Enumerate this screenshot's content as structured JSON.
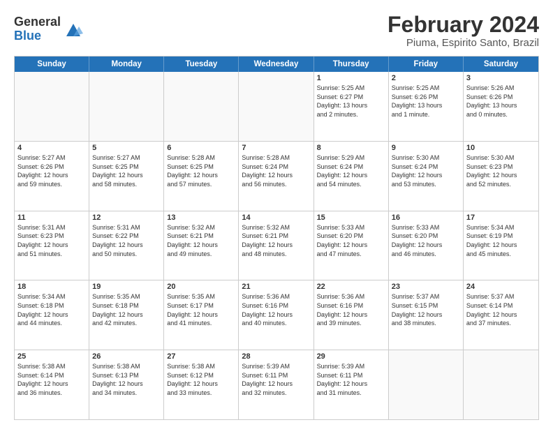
{
  "logo": {
    "general": "General",
    "blue": "Blue"
  },
  "title": "February 2024",
  "subtitle": "Piuma, Espirito Santo, Brazil",
  "header_days": [
    "Sunday",
    "Monday",
    "Tuesday",
    "Wednesday",
    "Thursday",
    "Friday",
    "Saturday"
  ],
  "weeks": [
    [
      {
        "day": "",
        "info": ""
      },
      {
        "day": "",
        "info": ""
      },
      {
        "day": "",
        "info": ""
      },
      {
        "day": "",
        "info": ""
      },
      {
        "day": "1",
        "info": "Sunrise: 5:25 AM\nSunset: 6:27 PM\nDaylight: 13 hours\nand 2 minutes."
      },
      {
        "day": "2",
        "info": "Sunrise: 5:25 AM\nSunset: 6:26 PM\nDaylight: 13 hours\nand 1 minute."
      },
      {
        "day": "3",
        "info": "Sunrise: 5:26 AM\nSunset: 6:26 PM\nDaylight: 13 hours\nand 0 minutes."
      }
    ],
    [
      {
        "day": "4",
        "info": "Sunrise: 5:27 AM\nSunset: 6:26 PM\nDaylight: 12 hours\nand 59 minutes."
      },
      {
        "day": "5",
        "info": "Sunrise: 5:27 AM\nSunset: 6:25 PM\nDaylight: 12 hours\nand 58 minutes."
      },
      {
        "day": "6",
        "info": "Sunrise: 5:28 AM\nSunset: 6:25 PM\nDaylight: 12 hours\nand 57 minutes."
      },
      {
        "day": "7",
        "info": "Sunrise: 5:28 AM\nSunset: 6:24 PM\nDaylight: 12 hours\nand 56 minutes."
      },
      {
        "day": "8",
        "info": "Sunrise: 5:29 AM\nSunset: 6:24 PM\nDaylight: 12 hours\nand 54 minutes."
      },
      {
        "day": "9",
        "info": "Sunrise: 5:30 AM\nSunset: 6:24 PM\nDaylight: 12 hours\nand 53 minutes."
      },
      {
        "day": "10",
        "info": "Sunrise: 5:30 AM\nSunset: 6:23 PM\nDaylight: 12 hours\nand 52 minutes."
      }
    ],
    [
      {
        "day": "11",
        "info": "Sunrise: 5:31 AM\nSunset: 6:23 PM\nDaylight: 12 hours\nand 51 minutes."
      },
      {
        "day": "12",
        "info": "Sunrise: 5:31 AM\nSunset: 6:22 PM\nDaylight: 12 hours\nand 50 minutes."
      },
      {
        "day": "13",
        "info": "Sunrise: 5:32 AM\nSunset: 6:21 PM\nDaylight: 12 hours\nand 49 minutes."
      },
      {
        "day": "14",
        "info": "Sunrise: 5:32 AM\nSunset: 6:21 PM\nDaylight: 12 hours\nand 48 minutes."
      },
      {
        "day": "15",
        "info": "Sunrise: 5:33 AM\nSunset: 6:20 PM\nDaylight: 12 hours\nand 47 minutes."
      },
      {
        "day": "16",
        "info": "Sunrise: 5:33 AM\nSunset: 6:20 PM\nDaylight: 12 hours\nand 46 minutes."
      },
      {
        "day": "17",
        "info": "Sunrise: 5:34 AM\nSunset: 6:19 PM\nDaylight: 12 hours\nand 45 minutes."
      }
    ],
    [
      {
        "day": "18",
        "info": "Sunrise: 5:34 AM\nSunset: 6:18 PM\nDaylight: 12 hours\nand 44 minutes."
      },
      {
        "day": "19",
        "info": "Sunrise: 5:35 AM\nSunset: 6:18 PM\nDaylight: 12 hours\nand 42 minutes."
      },
      {
        "day": "20",
        "info": "Sunrise: 5:35 AM\nSunset: 6:17 PM\nDaylight: 12 hours\nand 41 minutes."
      },
      {
        "day": "21",
        "info": "Sunrise: 5:36 AM\nSunset: 6:16 PM\nDaylight: 12 hours\nand 40 minutes."
      },
      {
        "day": "22",
        "info": "Sunrise: 5:36 AM\nSunset: 6:16 PM\nDaylight: 12 hours\nand 39 minutes."
      },
      {
        "day": "23",
        "info": "Sunrise: 5:37 AM\nSunset: 6:15 PM\nDaylight: 12 hours\nand 38 minutes."
      },
      {
        "day": "24",
        "info": "Sunrise: 5:37 AM\nSunset: 6:14 PM\nDaylight: 12 hours\nand 37 minutes."
      }
    ],
    [
      {
        "day": "25",
        "info": "Sunrise: 5:38 AM\nSunset: 6:14 PM\nDaylight: 12 hours\nand 36 minutes."
      },
      {
        "day": "26",
        "info": "Sunrise: 5:38 AM\nSunset: 6:13 PM\nDaylight: 12 hours\nand 34 minutes."
      },
      {
        "day": "27",
        "info": "Sunrise: 5:38 AM\nSunset: 6:12 PM\nDaylight: 12 hours\nand 33 minutes."
      },
      {
        "day": "28",
        "info": "Sunrise: 5:39 AM\nSunset: 6:11 PM\nDaylight: 12 hours\nand 32 minutes."
      },
      {
        "day": "29",
        "info": "Sunrise: 5:39 AM\nSunset: 6:11 PM\nDaylight: 12 hours\nand 31 minutes."
      },
      {
        "day": "",
        "info": ""
      },
      {
        "day": "",
        "info": ""
      }
    ]
  ]
}
